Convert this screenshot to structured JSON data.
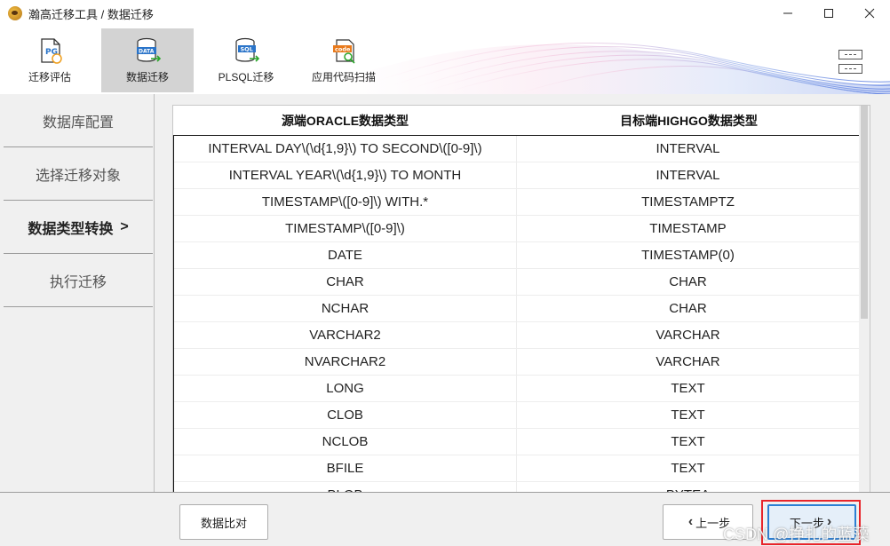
{
  "window": {
    "title": "瀚高迁移工具 / 数据迁移",
    "controls": [
      "minimize-icon",
      "maximize-icon",
      "close-icon"
    ]
  },
  "toolbar": {
    "items": [
      {
        "label": "迁移评估",
        "icon": "pg-document-icon",
        "active": false
      },
      {
        "label": "数据迁移",
        "icon": "database-data-icon",
        "active": true
      },
      {
        "label": "PLSQL迁移",
        "icon": "sql-database-icon",
        "active": false
      },
      {
        "label": "应用代码扫描",
        "icon": "code-scan-icon",
        "active": false
      }
    ],
    "menu_icon": "menu-icon"
  },
  "sidebar": {
    "items": [
      {
        "label": "数据库配置",
        "active": false
      },
      {
        "label": "选择迁移对象",
        "active": false
      },
      {
        "label": "数据类型转换",
        "active": true,
        "suffix": ">"
      },
      {
        "label": "执行迁移",
        "active": false
      }
    ]
  },
  "table": {
    "headers": [
      "源端ORACLE数据类型",
      "目标端HIGHGO数据类型"
    ],
    "rows": [
      [
        "INTERVAL DAY\\(\\d{1,9}\\) TO SECOND\\([0-9]\\)",
        "INTERVAL"
      ],
      [
        "INTERVAL YEAR\\(\\d{1,9}\\) TO MONTH",
        "INTERVAL"
      ],
      [
        "TIMESTAMP\\([0-9]\\) WITH.*",
        "TIMESTAMPTZ"
      ],
      [
        "TIMESTAMP\\([0-9]\\)",
        "TIMESTAMP"
      ],
      [
        "DATE",
        "TIMESTAMP(0)"
      ],
      [
        "CHAR",
        "CHAR"
      ],
      [
        "NCHAR",
        "CHAR"
      ],
      [
        "VARCHAR2",
        "VARCHAR"
      ],
      [
        "NVARCHAR2",
        "VARCHAR"
      ],
      [
        "LONG",
        "TEXT"
      ],
      [
        "CLOB",
        "TEXT"
      ],
      [
        "NCLOB",
        "TEXT"
      ],
      [
        "BFILE",
        "TEXT"
      ],
      [
        "BLOB",
        "BYTEA"
      ]
    ]
  },
  "footer": {
    "compare_label": "数据比对",
    "prev_label": "上一步",
    "next_label": "下一步",
    "watermark": "CSDN @挣扎的蓝藻"
  },
  "colors": {
    "active_toolbar_bg": "#d3d3d3",
    "highlight_border": "#e8242a",
    "next_button_border": "#2d7fd3"
  }
}
